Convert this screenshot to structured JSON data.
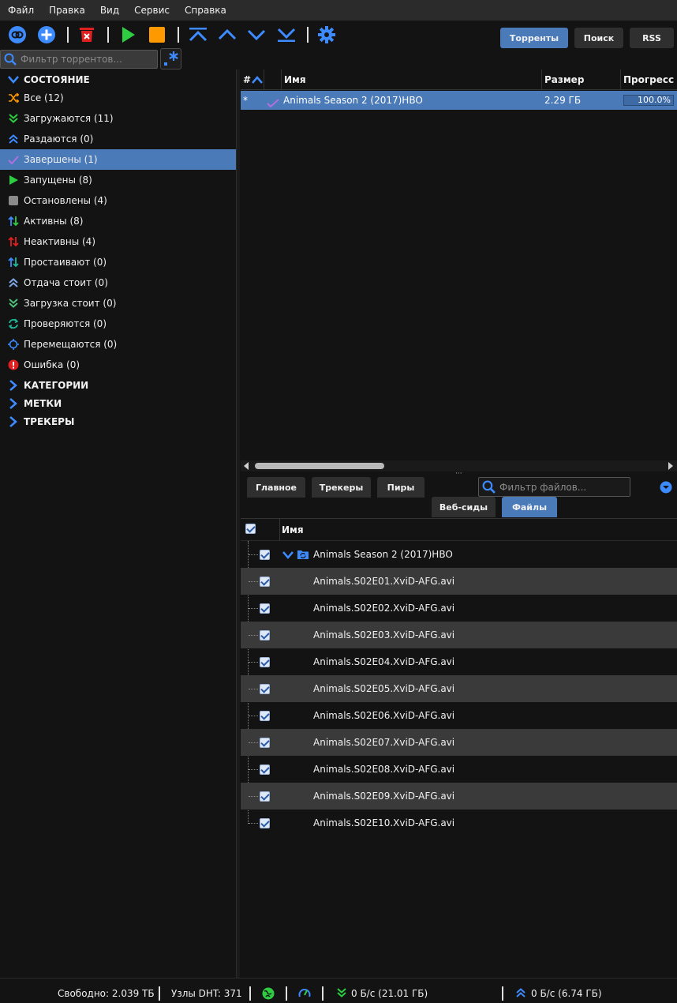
{
  "menu": [
    "Файл",
    "Правка",
    "Вид",
    "Сервис",
    "Справка"
  ],
  "top_tabs": {
    "torrents": "Торренты",
    "search": "Поиск",
    "rss": "RSS",
    "active": "torrents"
  },
  "filter": {
    "placeholder": "Фильтр торрентов..."
  },
  "sidebar": {
    "state_header": "СОСТОЯНИЕ",
    "items": [
      {
        "label": "Все (12)"
      },
      {
        "label": "Загружаются (11)"
      },
      {
        "label": "Раздаются (0)"
      },
      {
        "label": "Завершены (1)",
        "selected": true
      },
      {
        "label": "Запущены (8)"
      },
      {
        "label": "Остановлены (4)"
      },
      {
        "label": "Активны (8)"
      },
      {
        "label": "Неактивны (4)"
      },
      {
        "label": "Простаивают (0)"
      },
      {
        "label": "Отдача стоит (0)"
      },
      {
        "label": "Загрузка стоит (0)"
      },
      {
        "label": "Проверяются (0)"
      },
      {
        "label": "Перемещаются (0)"
      },
      {
        "label": "Ошибка (0)"
      }
    ],
    "categories": "КАТЕГОРИИ",
    "tags": "МЕТКИ",
    "trackers": "ТРЕКЕРЫ"
  },
  "torrent_table": {
    "columns": {
      "num": "#",
      "name": "Имя",
      "size": "Размер",
      "progress": "Прогресс"
    },
    "rows": [
      {
        "num": "*",
        "name": "Animals Season 2 (2017)HBO",
        "size": "2.29 ГБ",
        "progress": "100.0%"
      }
    ]
  },
  "details": {
    "tabs": {
      "general": "Главное",
      "trackers": "Трекеры",
      "peers": "Пиры",
      "webseeds": "Веб-сиды",
      "files": "Файлы"
    },
    "file_filter_placeholder": "Фильтр файлов...",
    "files_header": "Имя",
    "folder": "Animals Season 2 (2017)HBO",
    "files": [
      "Animals.S02E01.XviD-AFG.avi",
      "Animals.S02E02.XviD-AFG.avi",
      "Animals.S02E03.XviD-AFG.avi",
      "Animals.S02E04.XviD-AFG.avi",
      "Animals.S02E05.XviD-AFG.avi",
      "Animals.S02E06.XviD-AFG.avi",
      "Animals.S02E07.XviD-AFG.avi",
      "Animals.S02E08.XviD-AFG.avi",
      "Animals.S02E09.XviD-AFG.avi",
      "Animals.S02E10.XviD-AFG.avi"
    ]
  },
  "status": {
    "free": "Свободно: 2.039 ТБ",
    "dht": "Узлы DHT: 371",
    "down": "0 Б/с (21.01 ГБ)",
    "up": "0 Б/с (6.74 ГБ)"
  },
  "colors": {
    "accent": "#4a7ab8",
    "green": "#2ecc40",
    "orange": "#ff9900",
    "blue_icon": "#3d8bff",
    "red": "#e02020"
  }
}
